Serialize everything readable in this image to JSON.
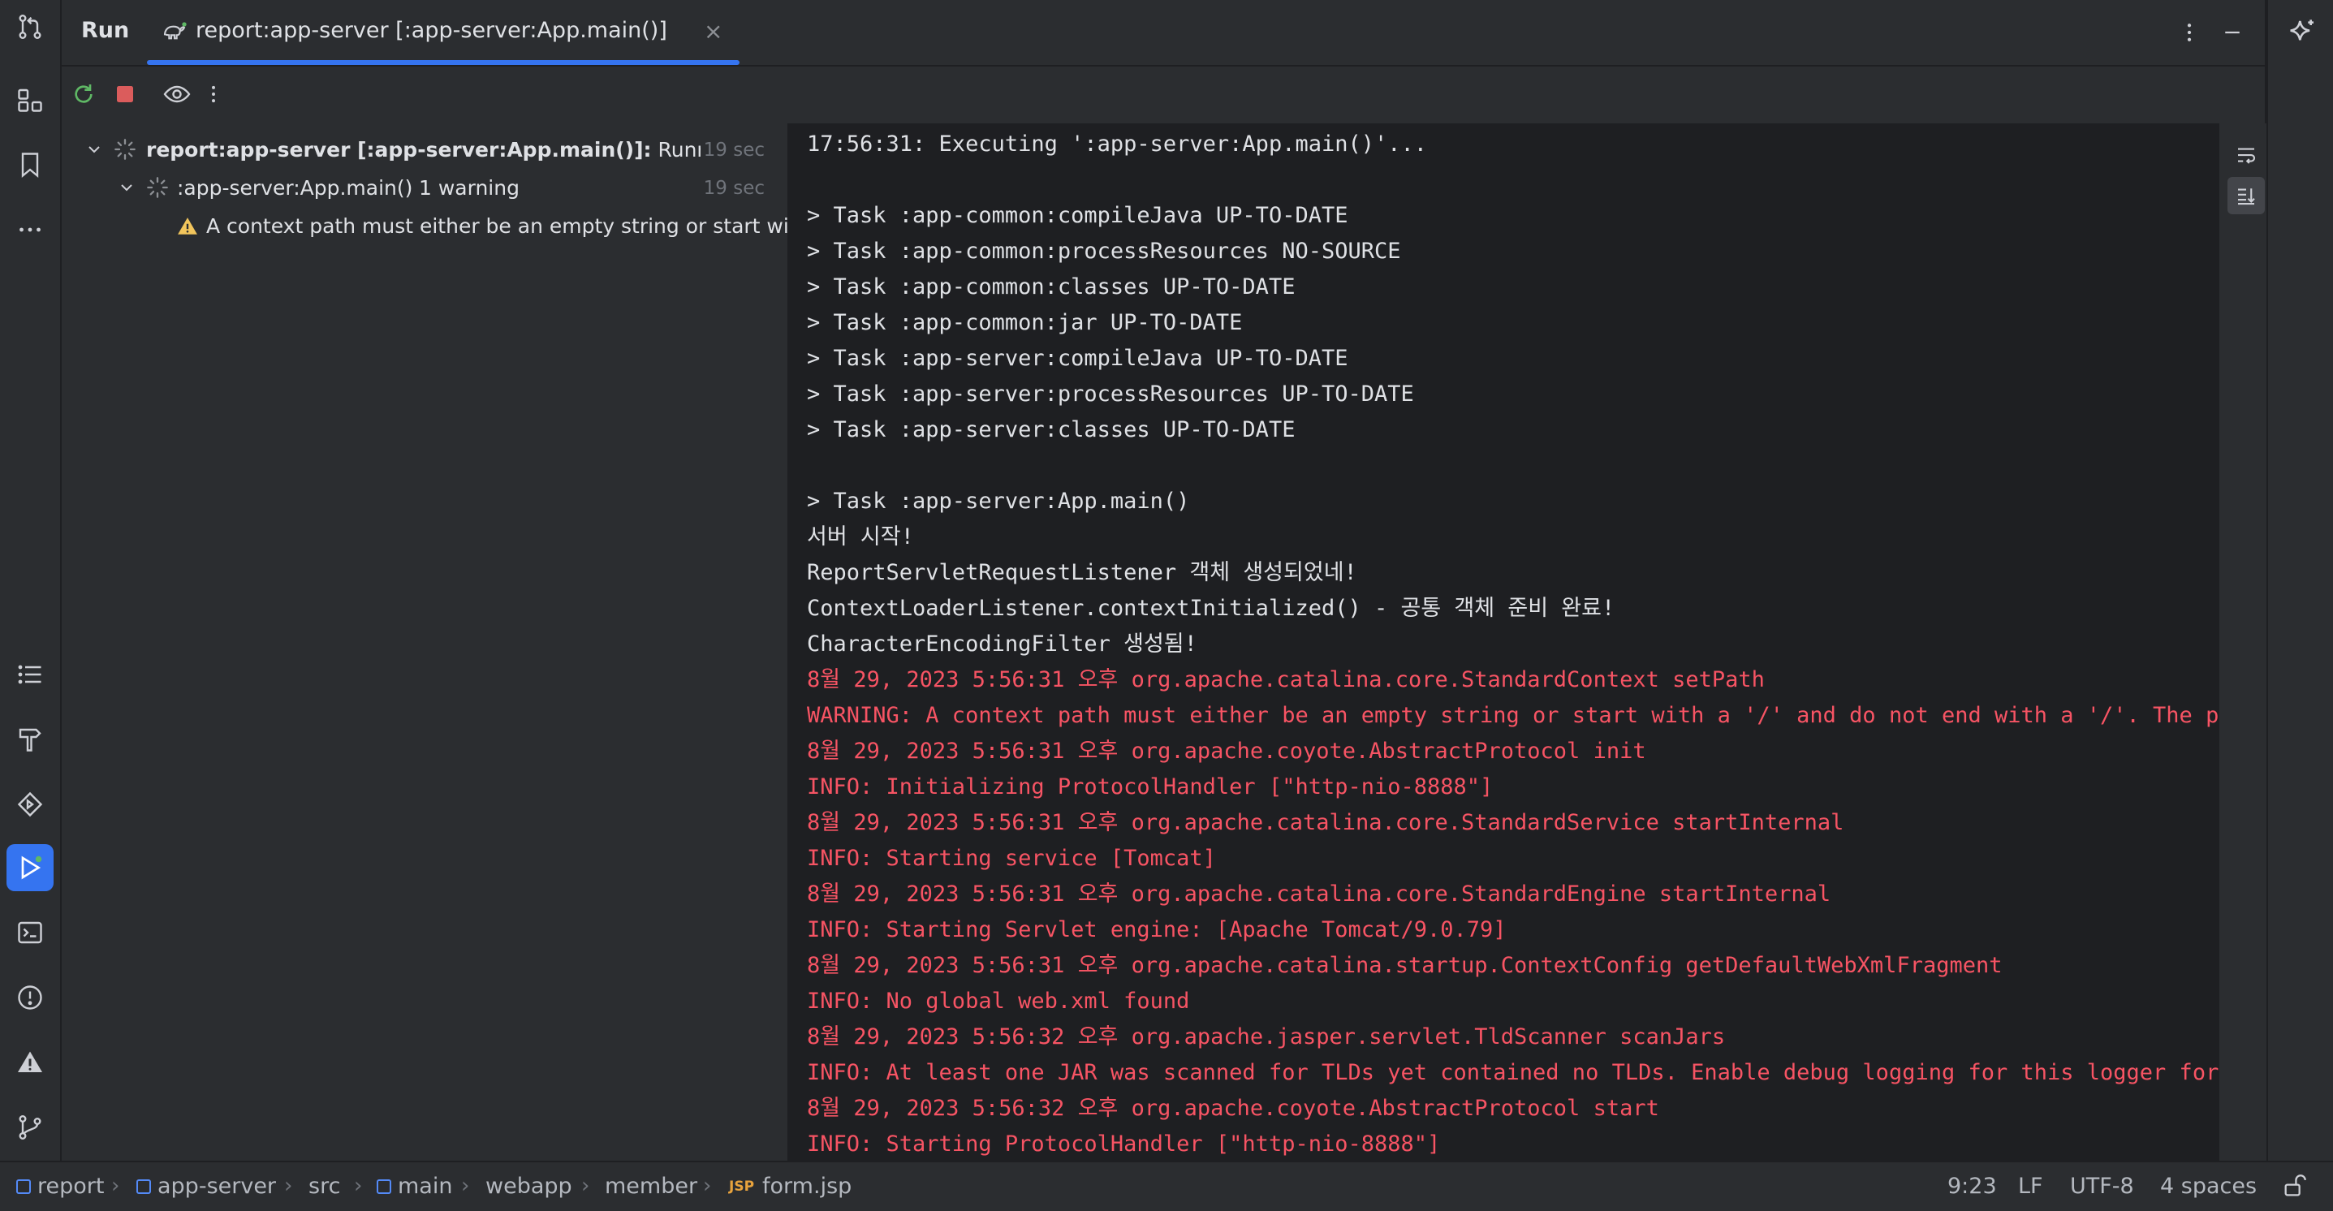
{
  "header": {
    "run_title": "Run",
    "tab_label": "report:app-server [:app-server:App.main()]",
    "tab_close": "×"
  },
  "tree": {
    "root": {
      "label": "report:app-server [:app-server:App.main()]:",
      "status": " Running t",
      "time": "19 sec"
    },
    "child": {
      "label": ":app-server:App.main()",
      "warning_count": "1 warning",
      "time": "19 sec"
    },
    "warning": {
      "text": "A context path must either be an empty string or start with"
    }
  },
  "console": {
    "lines": [
      {
        "text": "17:56:31: Executing ':app-server:App.main()'...",
        "kind": "normal"
      },
      {
        "text": "",
        "kind": "normal"
      },
      {
        "text": "> Task :app-common:compileJava UP-TO-DATE",
        "kind": "normal"
      },
      {
        "text": "> Task :app-common:processResources NO-SOURCE",
        "kind": "normal"
      },
      {
        "text": "> Task :app-common:classes UP-TO-DATE",
        "kind": "normal"
      },
      {
        "text": "> Task :app-common:jar UP-TO-DATE",
        "kind": "normal"
      },
      {
        "text": "> Task :app-server:compileJava UP-TO-DATE",
        "kind": "normal"
      },
      {
        "text": "> Task :app-server:processResources UP-TO-DATE",
        "kind": "normal"
      },
      {
        "text": "> Task :app-server:classes UP-TO-DATE",
        "kind": "normal"
      },
      {
        "text": "",
        "kind": "normal"
      },
      {
        "text": "> Task :app-server:App.main()",
        "kind": "normal"
      },
      {
        "text": "서버 시작!",
        "kind": "normal"
      },
      {
        "text": "ReportServletRequestListener 객체 생성되었네!",
        "kind": "normal"
      },
      {
        "text": "ContextLoaderListener.contextInitialized() - 공통 객체 준비 완료!",
        "kind": "normal"
      },
      {
        "text": "CharacterEncodingFilter 생성됨!",
        "kind": "normal"
      },
      {
        "text": "8월 29, 2023 5:56:31 오후 org.apache.catalina.core.StandardContext setPath",
        "kind": "err"
      },
      {
        "text": "WARNING: A context path must either be an empty string or start with a '/' and do not end with a '/'. The path [/] c",
        "kind": "err"
      },
      {
        "text": "8월 29, 2023 5:56:31 오후 org.apache.coyote.AbstractProtocol init",
        "kind": "err"
      },
      {
        "text": "INFO: Initializing ProtocolHandler [\"http-nio-8888\"]",
        "kind": "err"
      },
      {
        "text": "8월 29, 2023 5:56:31 오후 org.apache.catalina.core.StandardService startInternal",
        "kind": "err"
      },
      {
        "text": "INFO: Starting service [Tomcat]",
        "kind": "err"
      },
      {
        "text": "8월 29, 2023 5:56:31 오후 org.apache.catalina.core.StandardEngine startInternal",
        "kind": "err"
      },
      {
        "text": "INFO: Starting Servlet engine: [Apache Tomcat/9.0.79]",
        "kind": "err"
      },
      {
        "text": "8월 29, 2023 5:56:31 오후 org.apache.catalina.startup.ContextConfig getDefaultWebXmlFragment",
        "kind": "err"
      },
      {
        "text": "INFO: No global web.xml found",
        "kind": "err"
      },
      {
        "text": "8월 29, 2023 5:56:32 오후 org.apache.jasper.servlet.TldScanner scanJars",
        "kind": "err"
      },
      {
        "text": "INFO: At least one JAR was scanned for TLDs yet contained no TLDs. Enable debug logging for this logger for a comple",
        "kind": "err"
      },
      {
        "text": "8월 29, 2023 5:56:32 오후 org.apache.coyote.AbstractProtocol start",
        "kind": "err"
      },
      {
        "text": "INFO: Starting ProtocolHandler [\"http-nio-8888\"]",
        "kind": "err"
      }
    ]
  },
  "breadcrumbs": {
    "report": "report",
    "app_server": "app-server",
    "src": "src",
    "main": "main",
    "webapp": "webapp",
    "member": "member",
    "file_badge": "JSP",
    "file": "form.jsp",
    "separator": "›"
  },
  "status": {
    "position": "9:23",
    "line_sep": "LF",
    "encoding": "UTF-8",
    "indent": "4 spaces"
  },
  "colors": {
    "accent": "#3574f0",
    "error_text": "#f75464",
    "warning": "#f2c55c",
    "run_green": "#5fb865",
    "stop_red": "#db5c5c"
  }
}
